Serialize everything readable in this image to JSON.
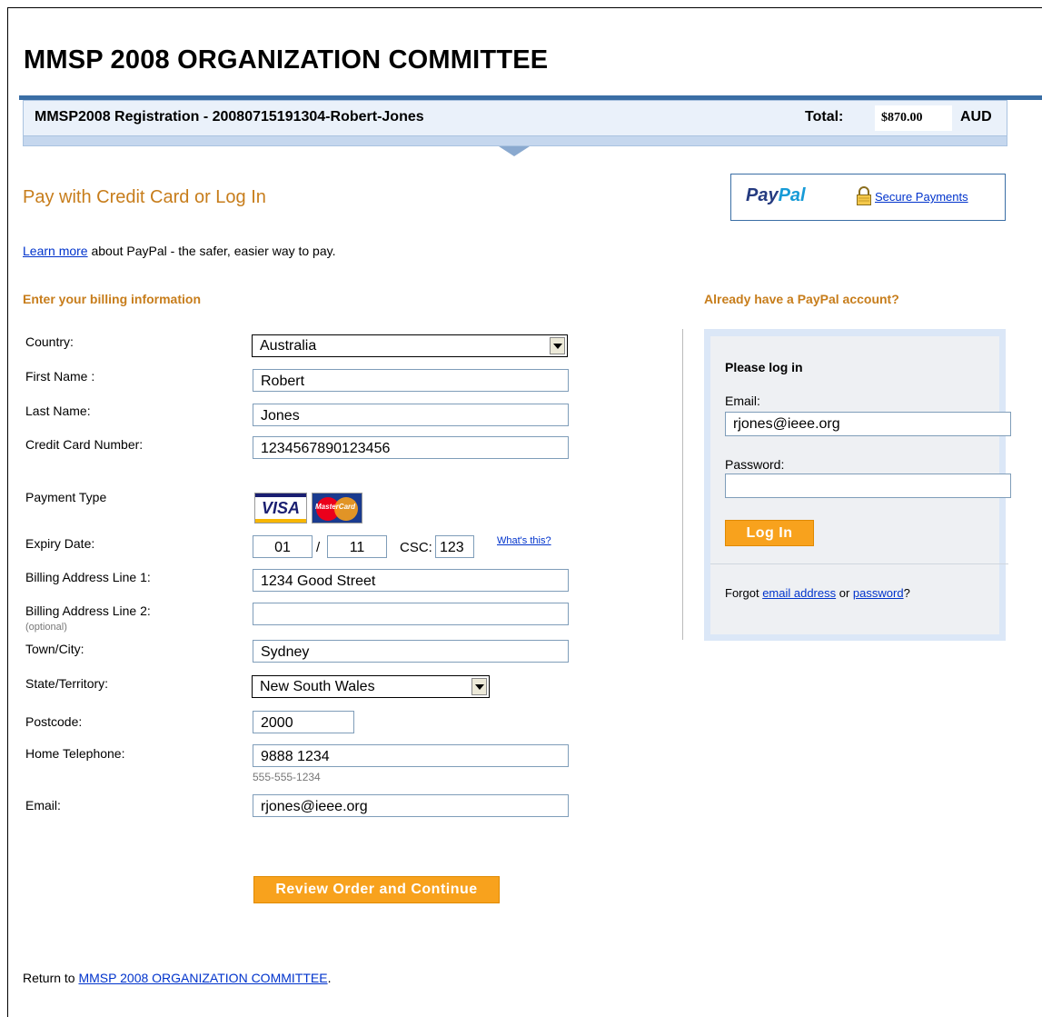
{
  "page_title": "MMSP 2008 ORGANIZATION COMMITTEE",
  "registration": {
    "title": "MMSP2008 Registration - 20080715191304-Robert-Jones",
    "total_label": "Total:",
    "total_value": "$870.00",
    "currency": "AUD"
  },
  "pay_heading": "Pay with Credit Card or Log In",
  "paypal": {
    "logo_pay": "Pay",
    "logo_pal": "Pal",
    "secure_link": "Secure Payments",
    "brand_color": "#253b80"
  },
  "learn": {
    "link": "Learn more",
    "text": " about PayPal - the safer, easier way to pay."
  },
  "billing": {
    "heading": "Enter your billing information",
    "country_label": "Country:",
    "country_value": "Australia",
    "first_name_label": "First Name :",
    "first_name_value": "Robert",
    "last_name_label": "Last Name:",
    "last_name_value": "Jones",
    "card_number_label": "Credit Card Number:",
    "card_number_value": "1234567890123456",
    "payment_type_label": "Payment Type",
    "card_types": [
      "VISA",
      "MasterCard"
    ],
    "expiry_label": "Expiry Date:",
    "expiry_month": "01",
    "expiry_sep": "/",
    "expiry_year": "11",
    "csc_label": "CSC:",
    "csc_value": "123",
    "whats_this": "What's this?",
    "address1_label": "Billing Address Line 1:",
    "address1_value": "1234 Good Street",
    "address2_label": "Billing Address Line 2:",
    "address2_optional": "(optional)",
    "address2_value": "",
    "city_label": "Town/City:",
    "city_value": "Sydney",
    "state_label": "State/Territory:",
    "state_value": "New South Wales",
    "postcode_label": "Postcode:",
    "postcode_value": "2000",
    "phone_label": "Home Telephone:",
    "phone_value": "9888 1234",
    "phone_hint": "555-555-1234",
    "email_label": "Email:",
    "email_value": "rjones@ieee.org",
    "submit_label": "Review Order and Continue"
  },
  "login": {
    "heading": "Already have a PayPal account?",
    "title": "Please log in",
    "email_label": "Email:",
    "email_value": "rjones@ieee.org",
    "password_label": "Password:",
    "password_value": "",
    "button_label": "Log In",
    "forgot_prefix": "Forgot ",
    "forgot_email_link": "email address",
    "forgot_or": " or ",
    "forgot_password_link": "password",
    "forgot_suffix": "?"
  },
  "footer": {
    "prefix": "Return to ",
    "link": "MMSP 2008 ORGANIZATION COMMITTEE",
    "suffix": "."
  },
  "colors": {
    "accent_orange": "#c77d1b",
    "button_orange": "#f8a21d",
    "header_blue": "#3a6ea5",
    "link_blue": "#0033cc"
  }
}
